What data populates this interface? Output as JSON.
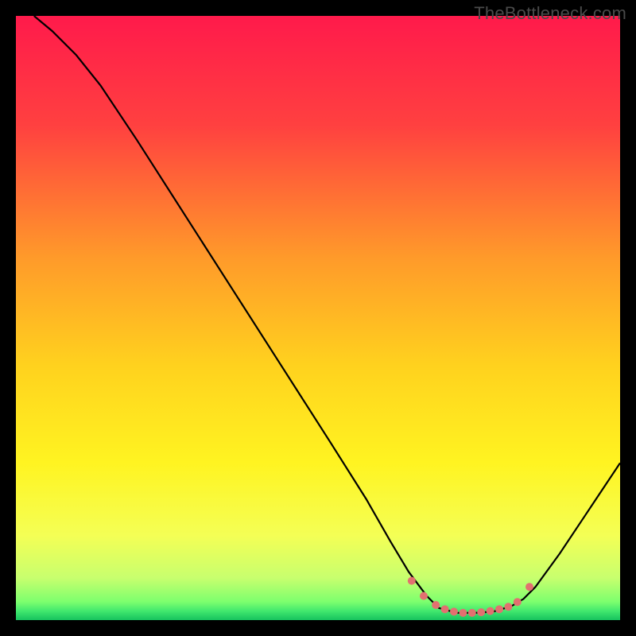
{
  "watermark": "TheBottleneck.com",
  "chart_data": {
    "type": "line",
    "title": "",
    "xlabel": "",
    "ylabel": "",
    "xlim": [
      0,
      100
    ],
    "ylim": [
      0,
      100
    ],
    "grid": false,
    "background": {
      "type": "vertical-gradient",
      "stops": [
        {
          "offset": 0.0,
          "color": "#ff1a4b"
        },
        {
          "offset": 0.18,
          "color": "#ff4040"
        },
        {
          "offset": 0.4,
          "color": "#ff9a2a"
        },
        {
          "offset": 0.58,
          "color": "#ffd21e"
        },
        {
          "offset": 0.74,
          "color": "#fff421"
        },
        {
          "offset": 0.86,
          "color": "#f4ff55"
        },
        {
          "offset": 0.93,
          "color": "#c8ff6e"
        },
        {
          "offset": 0.97,
          "color": "#7cff6e"
        },
        {
          "offset": 0.985,
          "color": "#41e86e"
        },
        {
          "offset": 1.0,
          "color": "#16c25e"
        }
      ]
    },
    "series": [
      {
        "name": "curve",
        "color": "#000000",
        "width": 2.2,
        "points": [
          {
            "x": 3.0,
            "y": 100.0
          },
          {
            "x": 6.0,
            "y": 97.5
          },
          {
            "x": 10.0,
            "y": 93.5
          },
          {
            "x": 14.0,
            "y": 88.5
          },
          {
            "x": 20.0,
            "y": 79.5
          },
          {
            "x": 28.0,
            "y": 67.0
          },
          {
            "x": 36.0,
            "y": 54.5
          },
          {
            "x": 44.0,
            "y": 42.0
          },
          {
            "x": 52.0,
            "y": 29.5
          },
          {
            "x": 58.0,
            "y": 20.0
          },
          {
            "x": 62.0,
            "y": 13.0
          },
          {
            "x": 65.0,
            "y": 8.0
          },
          {
            "x": 68.0,
            "y": 4.0
          },
          {
            "x": 70.0,
            "y": 2.0
          },
          {
            "x": 73.0,
            "y": 1.2
          },
          {
            "x": 76.0,
            "y": 1.2
          },
          {
            "x": 79.0,
            "y": 1.4
          },
          {
            "x": 82.0,
            "y": 2.3
          },
          {
            "x": 84.0,
            "y": 3.5
          },
          {
            "x": 86.0,
            "y": 5.5
          },
          {
            "x": 90.0,
            "y": 11.0
          },
          {
            "x": 94.0,
            "y": 17.0
          },
          {
            "x": 98.0,
            "y": 23.0
          },
          {
            "x": 100.0,
            "y": 26.0
          }
        ]
      }
    ],
    "markers": {
      "color": "#e27070",
      "radius_px": 5,
      "points": [
        {
          "x": 65.5,
          "y": 6.5
        },
        {
          "x": 67.5,
          "y": 4.0
        },
        {
          "x": 69.5,
          "y": 2.5
        },
        {
          "x": 71.0,
          "y": 1.8
        },
        {
          "x": 72.5,
          "y": 1.4
        },
        {
          "x": 74.0,
          "y": 1.2
        },
        {
          "x": 75.5,
          "y": 1.2
        },
        {
          "x": 77.0,
          "y": 1.3
        },
        {
          "x": 78.5,
          "y": 1.5
        },
        {
          "x": 80.0,
          "y": 1.8
        },
        {
          "x": 81.5,
          "y": 2.2
        },
        {
          "x": 83.0,
          "y": 3.0
        },
        {
          "x": 85.0,
          "y": 5.5
        }
      ]
    }
  }
}
